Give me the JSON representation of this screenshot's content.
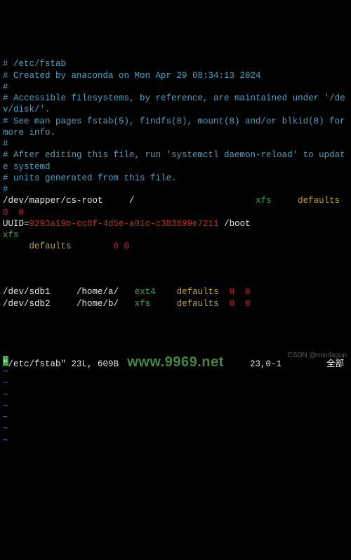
{
  "file": {
    "header_comment": "# /etc/fstab",
    "created_comment": "# Created by anaconda on Mon Apr 29 08:34:13 2024",
    "hash_line": "#",
    "accessible_comment": "# Accessible filesystems, by reference, are maintained under '/dev/disk/'.",
    "manpages_comment": "# See man pages fstab(5), findfs(8), mount(8) and/or blkid(8) for more info.",
    "after_edit_comment": "# After editing this file, run 'systemctl daemon-reload' to update systemd",
    "units_comment": "# units generated from this file."
  },
  "entry1": {
    "device": "/dev/mapper/cs-root",
    "mount": "/",
    "fstype": "xfs",
    "options": "defaults",
    "dump": "0",
    "pass": "0"
  },
  "entry2": {
    "uuid_label": "UUID=",
    "uuid_value": "9293a19b-cc8f-4d5e-a01c-c383899e7211",
    "mount": "/boot",
    "fstype": "xfs",
    "options": "defaults",
    "dump": "0",
    "pass": "0"
  },
  "entry3": {
    "device": "/dev/sdb1",
    "mount": "/home/a/",
    "fstype": "ext4",
    "options": "defaults",
    "dump": "0",
    "pass": "0"
  },
  "entry4": {
    "device": "/dev/sdb2",
    "mount": "/home/b/",
    "fstype": "xfs",
    "options": "defaults",
    "dump": "0",
    "pass": "0"
  },
  "tilde": "~",
  "status": {
    "left": "\"/etc/fstab\" 23L, 609B",
    "mid": "23,0-1",
    "right": "全部"
  },
  "watermark": "www.9969.net",
  "credit": "CSDN @minifagun"
}
